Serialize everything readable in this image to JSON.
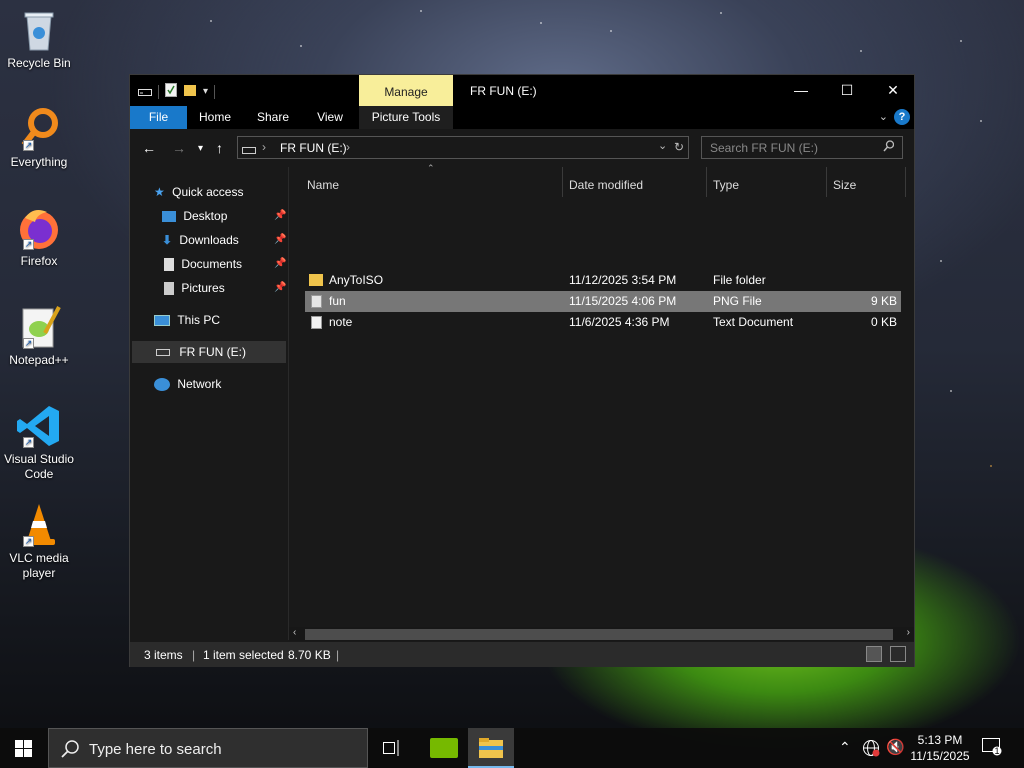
{
  "desktop": {
    "icons": [
      {
        "label": "Recycle Bin"
      },
      {
        "label": "Everything"
      },
      {
        "label": "Firefox"
      },
      {
        "label": "Notepad++"
      },
      {
        "label": "Visual Studio Code"
      },
      {
        "label": "VLC media player"
      }
    ]
  },
  "window": {
    "title": "FR FUN (E:)",
    "manage_tab": "Manage",
    "ribbon_tabs": [
      "File",
      "Home",
      "Share",
      "View",
      "Picture Tools"
    ],
    "address": "FR FUN (E:)",
    "search_placeholder": "Search FR FUN (E:)",
    "nav": {
      "quick_access": "Quick access",
      "quick_items": [
        "Desktop",
        "Downloads",
        "Documents",
        "Pictures"
      ],
      "this_pc": "This PC",
      "drive": "FR FUN (E:)",
      "network": "Network"
    },
    "columns": [
      "Name",
      "Date modified",
      "Type",
      "Size"
    ],
    "files": [
      {
        "name": "AnyToISO",
        "date": "11/12/2025 3:54 PM",
        "type": "File folder",
        "size": "",
        "icon": "folder-icon"
      },
      {
        "name": "fun",
        "date": "11/15/2025 4:06 PM",
        "type": "PNG File",
        "size": "9 KB",
        "icon": "image-file-icon"
      },
      {
        "name": "note",
        "date": "11/6/2025 4:36 PM",
        "type": "Text Document",
        "size": "0 KB",
        "icon": "text-file-icon"
      }
    ],
    "selected_row": 1,
    "status": {
      "items": "3 items",
      "selected": "1 item selected",
      "size": "8.70 KB"
    }
  },
  "taskbar": {
    "search_placeholder": "Type here to search",
    "time": "5:13 PM",
    "date": "11/15/2025",
    "notification_count": "1"
  },
  "colors": {
    "accent": "#1979ca",
    "manage_tab": "#f8ee9a",
    "selected_row": "#777777",
    "folder": "#f0c44c"
  }
}
